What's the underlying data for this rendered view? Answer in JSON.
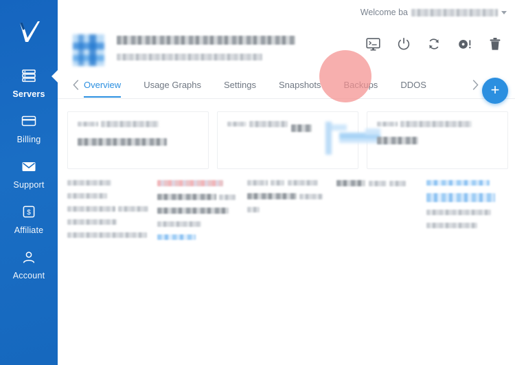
{
  "brand": {
    "logo_icon": "checkmark-logo",
    "sidebar_gradient_from": "#1565bf",
    "sidebar_gradient_to": "#1668be",
    "accent": "#2b8fe0",
    "highlight": "#f4908f"
  },
  "sidebar": {
    "items": [
      {
        "label": "Servers",
        "icon": "server-list-icon",
        "active": true
      },
      {
        "label": "Billing",
        "icon": "credit-card-icon",
        "active": false
      },
      {
        "label": "Support",
        "icon": "envelope-icon",
        "active": false
      },
      {
        "label": "Affiliate",
        "icon": "dollar-box-icon",
        "active": false
      },
      {
        "label": "Account",
        "icon": "person-icon",
        "active": false
      }
    ]
  },
  "topbar": {
    "welcome_prefix": "Welcome ba",
    "welcome_user_redacted": true,
    "caret_icon": "chevron-down-icon"
  },
  "server_header": {
    "avatar_icon": "server-avatar-redacted",
    "title_redacted": true,
    "subtitle_redacted": true,
    "actions": [
      {
        "name": "console-icon",
        "title": "Console"
      },
      {
        "name": "power-icon",
        "title": "Power"
      },
      {
        "name": "reboot-icon",
        "title": "Reboot"
      },
      {
        "name": "disc-alert-icon",
        "title": "Rescue ISO"
      },
      {
        "name": "trash-icon",
        "title": "Destroy"
      }
    ]
  },
  "tabs": {
    "prev_icon": "chevron-left-icon",
    "next_icon": "chevron-right-icon",
    "items": [
      {
        "label": "Overview",
        "active": true
      },
      {
        "label": "Usage Graphs",
        "active": false
      },
      {
        "label": "Settings",
        "active": false
      },
      {
        "label": "Snapshots",
        "active": false,
        "highlighted": true
      },
      {
        "label": "Backups",
        "active": false
      },
      {
        "label": "DDOS",
        "active": false
      }
    ]
  },
  "fab": {
    "label": "+",
    "icon": "plus-icon"
  },
  "content": {
    "cards": [
      {
        "lines": [
          14,
          34,
          58
        ],
        "has_chart": false,
        "redacted": true
      },
      {
        "lines": [
          12,
          26,
          18
        ],
        "has_chart": true,
        "redacted": true
      },
      {
        "lines": [
          14,
          40,
          38
        ],
        "has_chart": false,
        "redacted": true
      }
    ],
    "detail_columns": [
      {
        "rows": [
          {
            "k": 38,
            "v": 0
          },
          {
            "k": 36,
            "v": 0
          },
          {
            "k": 44,
            "v": 0
          },
          {
            "k": 46,
            "v": 0
          },
          {
            "k": 80,
            "v": 0
          }
        ]
      },
      {
        "rows": [
          {
            "k": 62,
            "v": 0
          },
          {
            "k": 58,
            "v": 0
          },
          {
            "k": 16,
            "v": 0
          },
          {
            "k": 78,
            "v": 0
          },
          {
            "k": 50,
            "v": 0
          }
        ]
      },
      {
        "rows": [
          {
            "k": 24,
            "v": 0
          },
          {
            "k": 14,
            "v": 0
          },
          {
            "k": 32,
            "v": 0
          },
          {
            "k": 64,
            "v": 0
          },
          {
            "k": 54,
            "v": 0
          }
        ]
      },
      {
        "rows": [
          {
            "k": 34,
            "v": 0
          },
          {
            "k": 30,
            "v": 0
          },
          {
            "k": 22,
            "v": 0
          },
          {
            "k": 0,
            "v": 0
          },
          {
            "k": 0,
            "v": 0
          }
        ]
      }
    ]
  }
}
